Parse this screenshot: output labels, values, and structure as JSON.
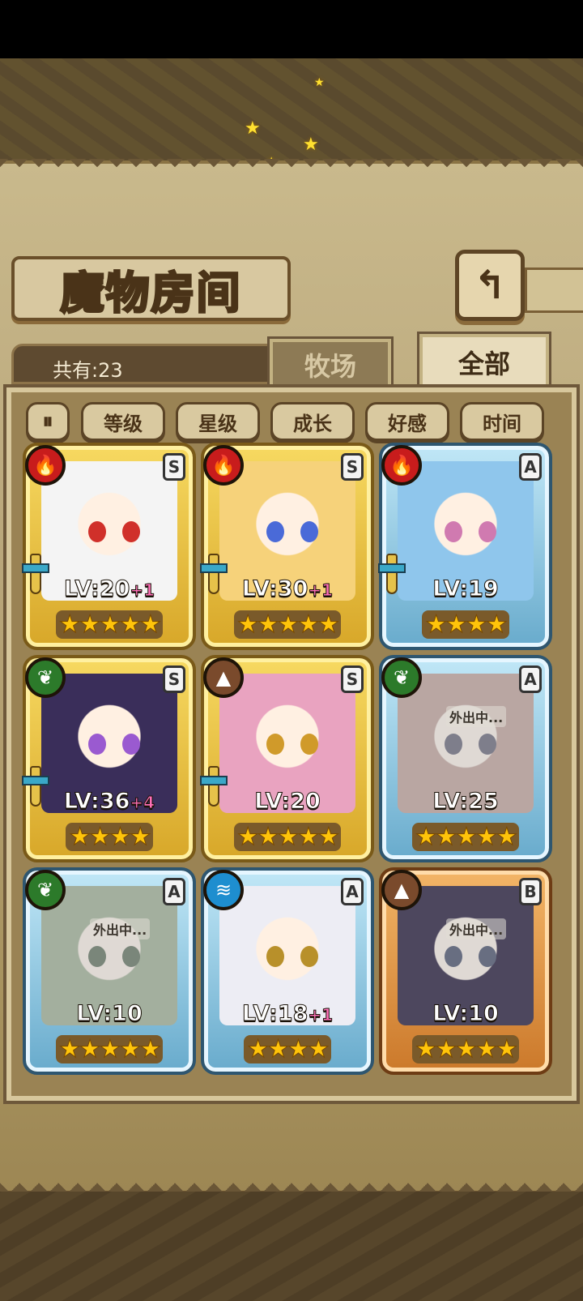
{
  "title": "魔物房间",
  "back_icon": "return-arrow-icon",
  "count": "共有:23",
  "tabs": [
    "牧场",
    "全部"
  ],
  "filters": [
    "等级",
    "星级",
    "成长",
    "好感",
    "时间"
  ],
  "monsters": [
    {
      "element": "fire",
      "rank": "S",
      "frame": "gold",
      "level": "LV:20",
      "plus": "+1",
      "stars": 5,
      "away": ""
    },
    {
      "element": "fire",
      "rank": "S",
      "frame": "gold",
      "level": "LV:30",
      "plus": "+1",
      "stars": 5,
      "away": ""
    },
    {
      "element": "fire",
      "rank": "A",
      "frame": "blue",
      "level": "LV:19",
      "plus": "",
      "stars": 4,
      "away": ""
    },
    {
      "element": "leaf",
      "rank": "S",
      "frame": "gold",
      "level": "LV:36",
      "plus": "+4",
      "stars": 4,
      "away": ""
    },
    {
      "element": "earth",
      "rank": "S",
      "frame": "gold",
      "level": "LV:20",
      "plus": "",
      "stars": 5,
      "away": ""
    },
    {
      "element": "leaf",
      "rank": "A",
      "frame": "blue",
      "level": "LV:25",
      "plus": "",
      "stars": 5,
      "away": "外出中..."
    },
    {
      "element": "leaf",
      "rank": "A",
      "frame": "blue",
      "level": "LV:10",
      "plus": "",
      "stars": 5,
      "away": "外出中..."
    },
    {
      "element": "water",
      "rank": "A",
      "frame": "blue",
      "level": "LV:18",
      "plus": "+1",
      "stars": 4,
      "away": ""
    },
    {
      "element": "earth",
      "rank": "B",
      "frame": "bronze",
      "level": "LV:10",
      "plus": "",
      "stars": 5,
      "away": "外出中..."
    }
  ]
}
